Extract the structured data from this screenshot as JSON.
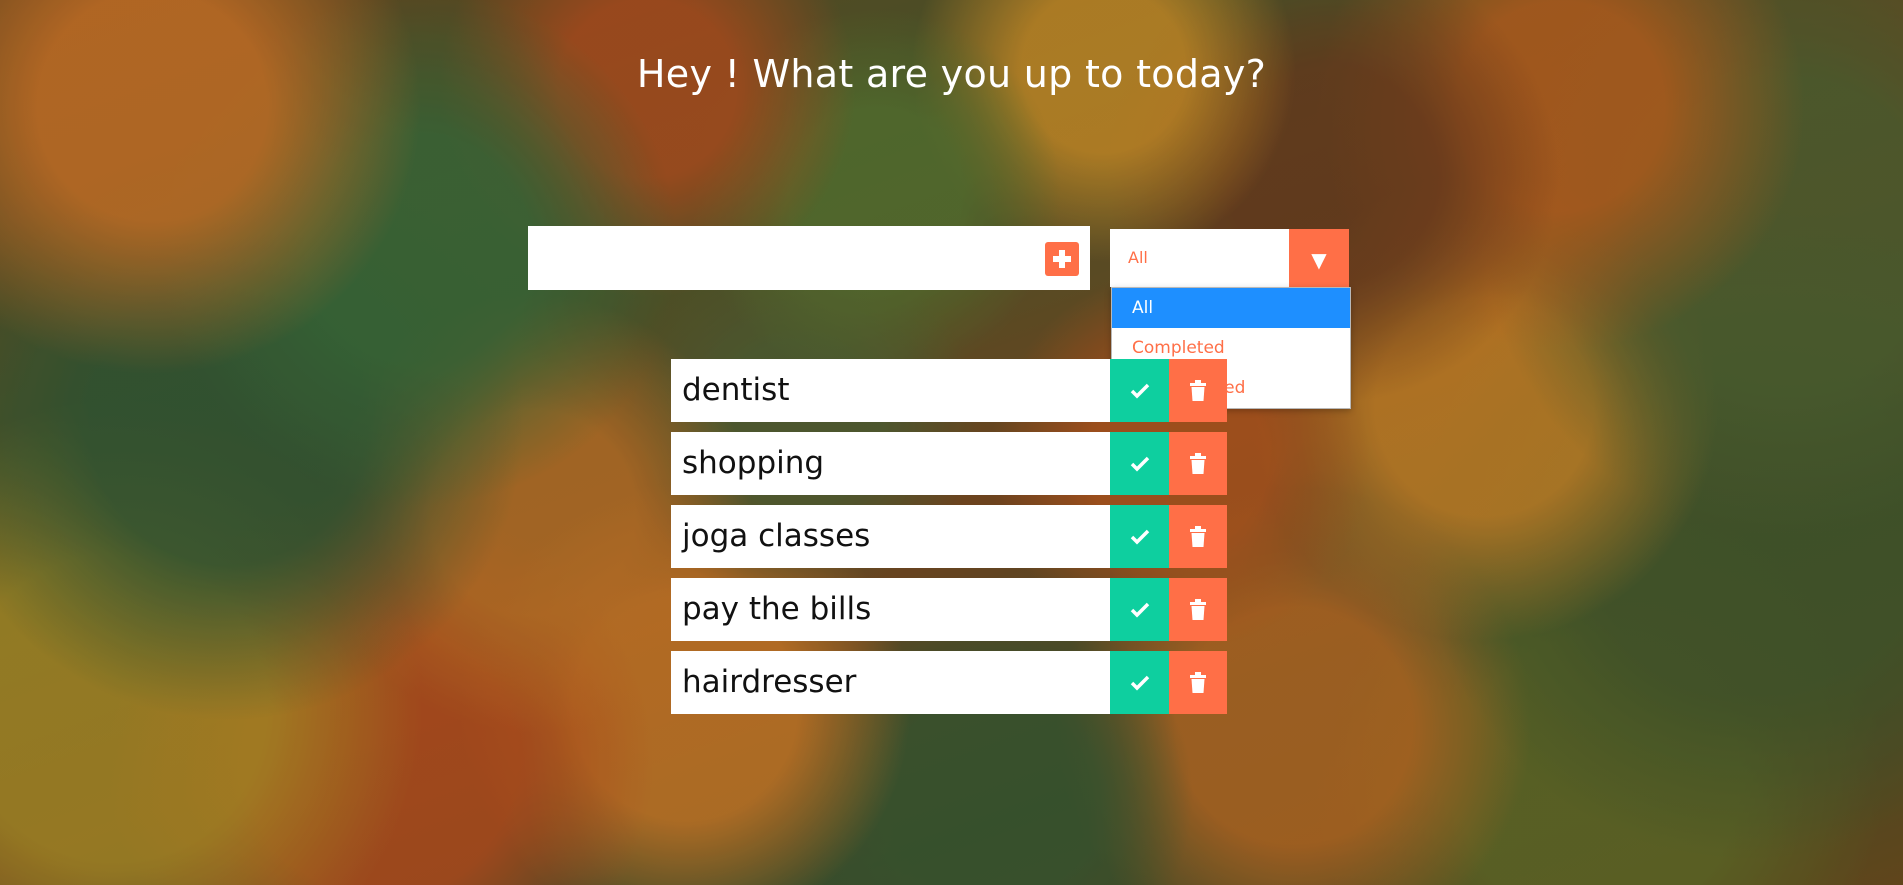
{
  "header": {
    "title": "Hey ! What are you up to today?"
  },
  "form": {
    "input_value": "",
    "add_icon": "plus-square-icon"
  },
  "filter": {
    "selected": "All",
    "arrow_glyph": "▼",
    "options": [
      "All",
      "Completed",
      "Uncompleted"
    ]
  },
  "todos": [
    {
      "text": "dentist"
    },
    {
      "text": "shopping"
    },
    {
      "text": "joga classes"
    },
    {
      "text": "pay the bills"
    },
    {
      "text": "hairdresser"
    }
  ],
  "colors": {
    "accent_orange": "#ff6f47",
    "complete_green": "#0ecf9f",
    "selected_blue": "#1e8fff"
  },
  "icons": {
    "complete": "check-icon",
    "delete": "trash-icon"
  }
}
